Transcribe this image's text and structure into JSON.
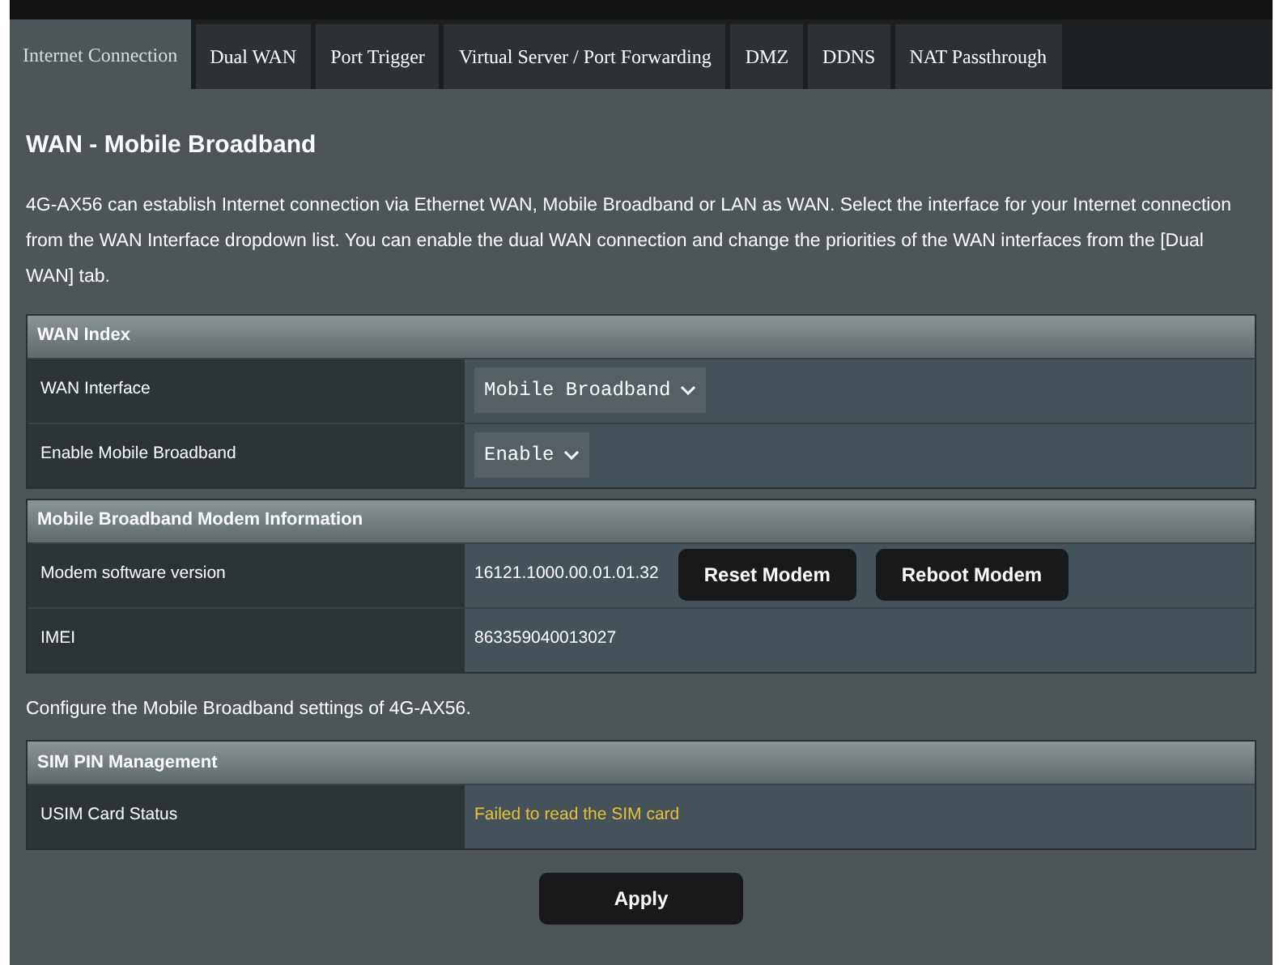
{
  "tabs": [
    {
      "label": "Internet Connection",
      "selected": true
    },
    {
      "label": "Dual WAN",
      "selected": false
    },
    {
      "label": "Port Trigger",
      "selected": false
    },
    {
      "label": "Virtual Server / Port Forwarding",
      "selected": false
    },
    {
      "label": "DMZ",
      "selected": false
    },
    {
      "label": "DDNS",
      "selected": false
    },
    {
      "label": "NAT Passthrough",
      "selected": false
    }
  ],
  "title": "WAN - Mobile Broadband",
  "description": "4G-AX56 can establish Internet connection via Ethernet WAN, Mobile Broadband or LAN as WAN. Select the interface for your Internet connection from the WAN Interface dropdown list. You can enable the dual WAN connection and change the priorities of the WAN interfaces from the [Dual WAN] tab.",
  "sections": [
    {
      "heading": "WAN Index",
      "rows": [
        {
          "kind": "select",
          "label": "WAN Interface",
          "value": "Mobile Broadband"
        },
        {
          "kind": "select",
          "label": "Enable Mobile Broadband",
          "value": "Enable"
        }
      ]
    },
    {
      "heading": "Mobile Broadband Modem Information",
      "rows": [
        {
          "kind": "buttons",
          "label": "Modem software version",
          "value": "16121.1000.00.01.01.32",
          "buttons": [
            "Reset Modem",
            "Reboot Modem"
          ]
        },
        {
          "kind": "text",
          "label": "IMEI",
          "value": "863359040013027"
        }
      ],
      "note_after": "Configure the Mobile Broadband settings of 4G-AX56."
    },
    {
      "heading": "SIM PIN Management",
      "rows": [
        {
          "kind": "warning",
          "label": "USIM Card Status",
          "value": "Failed to read the SIM card"
        }
      ]
    }
  ],
  "apply_button": "Apply"
}
